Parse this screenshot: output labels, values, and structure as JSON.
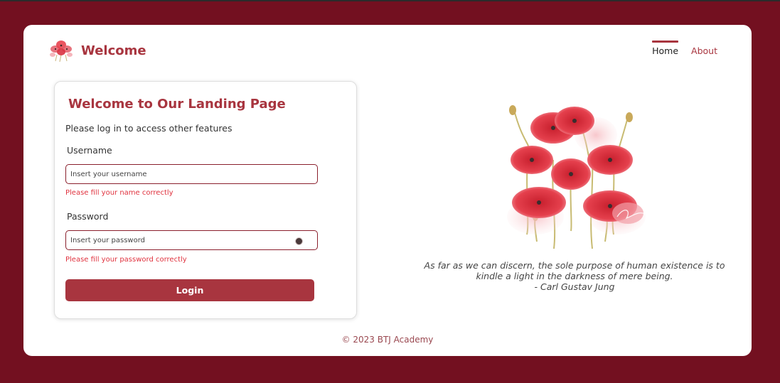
{
  "header": {
    "brand_title": "Welcome",
    "nav": [
      {
        "label": "Home",
        "active": true
      },
      {
        "label": "About",
        "active": false
      }
    ]
  },
  "login": {
    "title": "Welcome to Our Landing Page",
    "subtitle": "Please log in to access other features",
    "username_label": "Username",
    "username_placeholder": "Insert your username",
    "username_value": "",
    "username_error": "Please fill your name correctly",
    "password_label": "Password",
    "password_placeholder": "Insert your password",
    "password_value": "",
    "password_error": "Please fill your password correctly",
    "login_label": "Login"
  },
  "quote": {
    "line1": "As far as we can discern, the sole purpose of human existence is to",
    "line2": "kindle a light in the darkness of mere being.",
    "author": "- Carl Gustav Jung"
  },
  "footer": {
    "text": "© 2023 BTJ Academy"
  },
  "colors": {
    "background": "#731020",
    "accent": "#a8353f",
    "error": "#e0333f",
    "input_border": "#8a1f2c"
  },
  "icons": {
    "brand_logo": "poppy-flower-icon",
    "password_toggle": "eye-icon",
    "hero": "poppy-bouquet-illustration"
  }
}
